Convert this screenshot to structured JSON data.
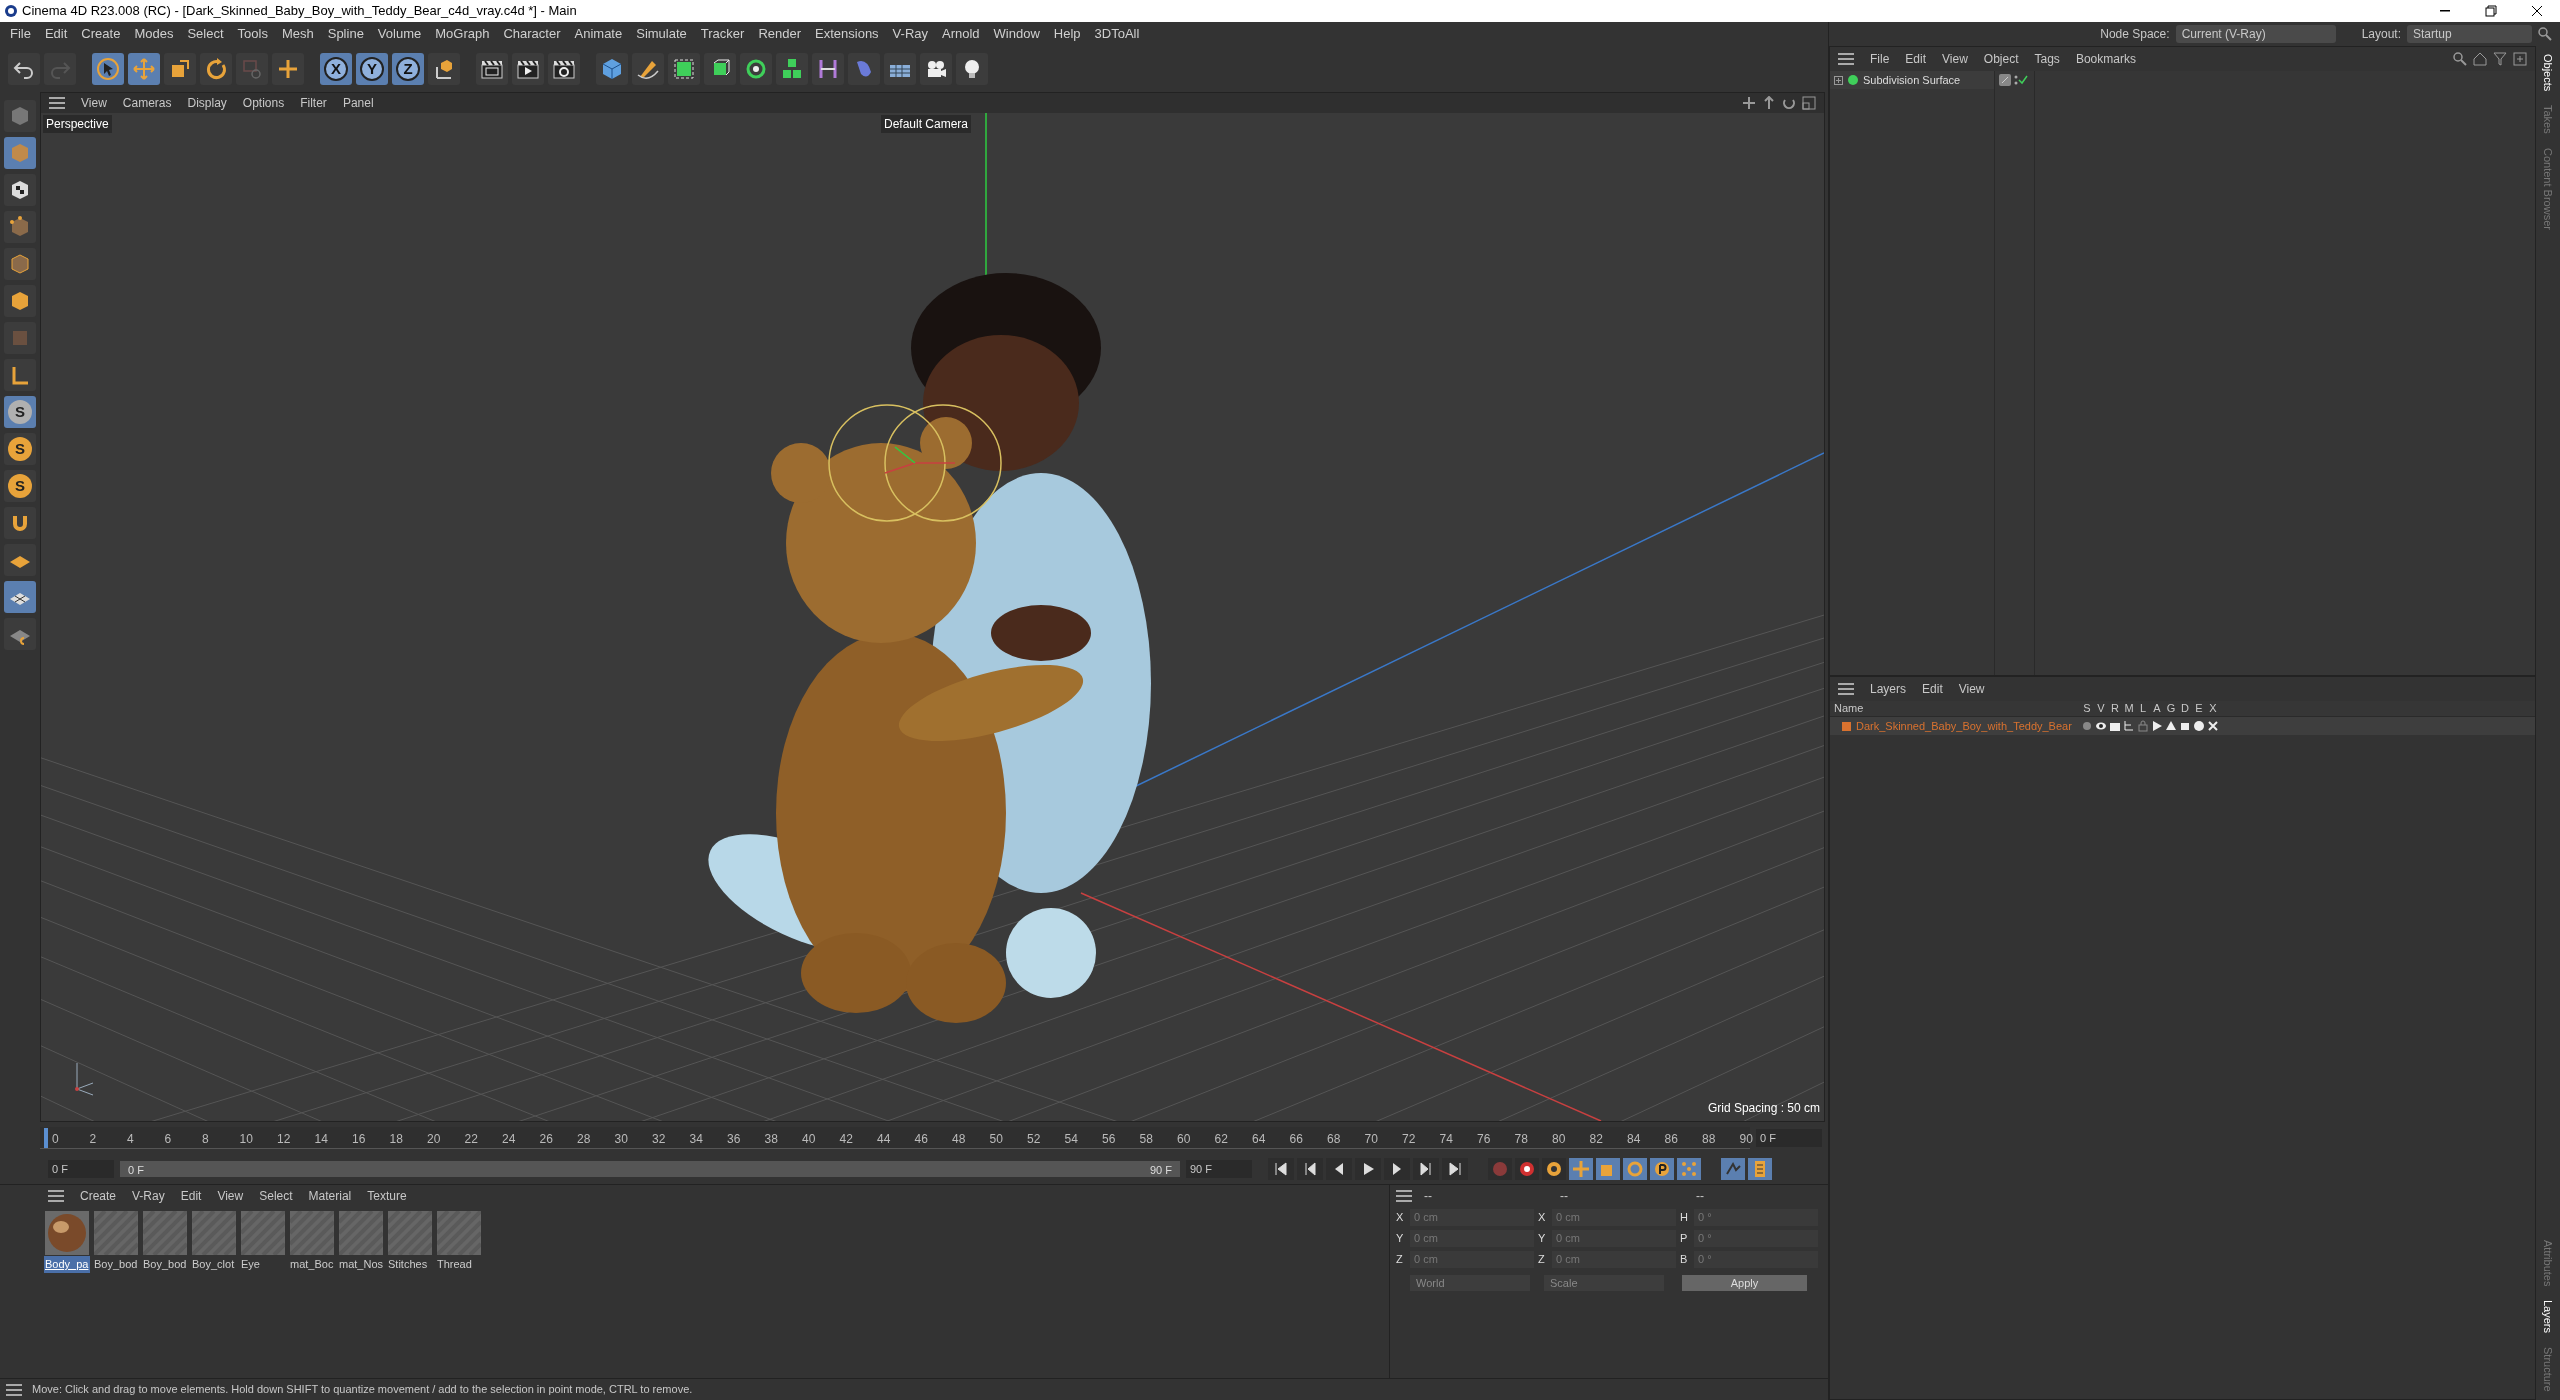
{
  "window": {
    "title": "Cinema 4D R23.008 (RC) - [Dark_Skinned_Baby_Boy_with_Teddy_Bear_c4d_vray.c4d *] - Main"
  },
  "menu": [
    "File",
    "Edit",
    "Create",
    "Modes",
    "Select",
    "Tools",
    "Mesh",
    "Spline",
    "Volume",
    "MoGraph",
    "Character",
    "Animate",
    "Simulate",
    "Tracker",
    "Render",
    "Extensions",
    "V-Ray",
    "Arnold",
    "Window",
    "Help",
    "3DToAll"
  ],
  "node_space": {
    "label": "Node Space:",
    "value": "Current (V-Ray)"
  },
  "layout": {
    "label": "Layout:",
    "value": "Startup"
  },
  "toolbar": {
    "axis_buttons": [
      {
        "label": "X",
        "selected": true
      },
      {
        "label": "Y",
        "selected": true
      },
      {
        "label": "Z",
        "selected": true
      }
    ]
  },
  "left_tools": {
    "snap_buttons": [
      {
        "label": "S",
        "selected": true
      },
      {
        "label": "S",
        "selected": false
      },
      {
        "label": "S",
        "selected": false
      }
    ]
  },
  "viewport": {
    "menu": [
      "View",
      "Cameras",
      "Display",
      "Options",
      "Filter",
      "Panel"
    ],
    "camera_view": "Perspective",
    "camera_name": "Default Camera",
    "grid_spacing": "Grid Spacing : 50 cm"
  },
  "timeline": {
    "ticks": [
      "0",
      "2",
      "4",
      "6",
      "8",
      "10",
      "12",
      "14",
      "16",
      "18",
      "20",
      "22",
      "24",
      "26",
      "28",
      "30",
      "32",
      "34",
      "36",
      "38",
      "40",
      "42",
      "44",
      "46",
      "48",
      "50",
      "52",
      "54",
      "56",
      "58",
      "60",
      "62",
      "64",
      "66",
      "68",
      "70",
      "72",
      "74",
      "76",
      "78",
      "80",
      "82",
      "84",
      "86",
      "88",
      "90"
    ],
    "current_frame": "0 F",
    "start_field": "0 F",
    "range": {
      "start": "0 F",
      "end": "90 F",
      "level": 1
    },
    "end_field": "90 F"
  },
  "materials": {
    "menu": [
      "Create",
      "V-Ray",
      "Edit",
      "View",
      "Select",
      "Material",
      "Texture"
    ],
    "items": [
      {
        "name": "Body_pa",
        "kind": "textured",
        "selected": true
      },
      {
        "name": "Boy_bod",
        "kind": "placeholder",
        "selected": false
      },
      {
        "name": "Boy_bod",
        "kind": "placeholder",
        "selected": false
      },
      {
        "name": "Boy_clot",
        "kind": "placeholder",
        "selected": false
      },
      {
        "name": "Eye",
        "kind": "placeholder",
        "selected": false
      },
      {
        "name": "mat_Boc",
        "kind": "placeholder",
        "selected": false
      },
      {
        "name": "mat_Nos",
        "kind": "placeholder",
        "selected": false
      },
      {
        "name": "Stitches",
        "kind": "placeholder",
        "selected": false
      },
      {
        "name": "Thread",
        "kind": "placeholder",
        "selected": false
      }
    ]
  },
  "coordinates": {
    "headers": [
      "--",
      "--",
      "--"
    ],
    "rows": [
      {
        "axis": "X",
        "position": "0 cm",
        "size_axis": "X",
        "size": "0 cm",
        "rot_axis": "H",
        "rotation": "0 °"
      },
      {
        "axis": "Y",
        "position": "0 cm",
        "size_axis": "Y",
        "size": "0 cm",
        "rot_axis": "P",
        "rotation": "0 °"
      },
      {
        "axis": "Z",
        "position": "0 cm",
        "size_axis": "Z",
        "size": "0 cm",
        "rot_axis": "B",
        "rotation": "0 °"
      }
    ],
    "mode": "World",
    "size_mode": "Scale",
    "apply": "Apply"
  },
  "status_bar": "Move: Click and drag to move elements. Hold down SHIFT to quantize movement / add to the selection in point mode, CTRL to remove.",
  "objects": {
    "menu": [
      "File",
      "Edit",
      "View",
      "Object",
      "Tags",
      "Bookmarks"
    ],
    "items": [
      {
        "name": "Subdivision Surface"
      }
    ]
  },
  "layers": {
    "menu": [
      "Layers",
      "Edit",
      "View"
    ],
    "name_header": "Name",
    "columns": [
      "S",
      "V",
      "R",
      "M",
      "L",
      "A",
      "G",
      "D",
      "E",
      "X"
    ],
    "items": [
      {
        "name": "Dark_Skinned_Baby_Boy_with_Teddy_Bear",
        "color": "#d9722f"
      }
    ]
  },
  "side_tabs_top": [
    {
      "label": "Objects",
      "selected": true
    },
    {
      "label": "Takes",
      "selected": false
    },
    {
      "label": "Content Browser",
      "selected": false
    }
  ],
  "side_tabs_bottom": [
    {
      "label": "Attributes",
      "selected": false
    },
    {
      "label": "Layers",
      "selected": true
    },
    {
      "label": "Structure",
      "selected": false
    }
  ]
}
